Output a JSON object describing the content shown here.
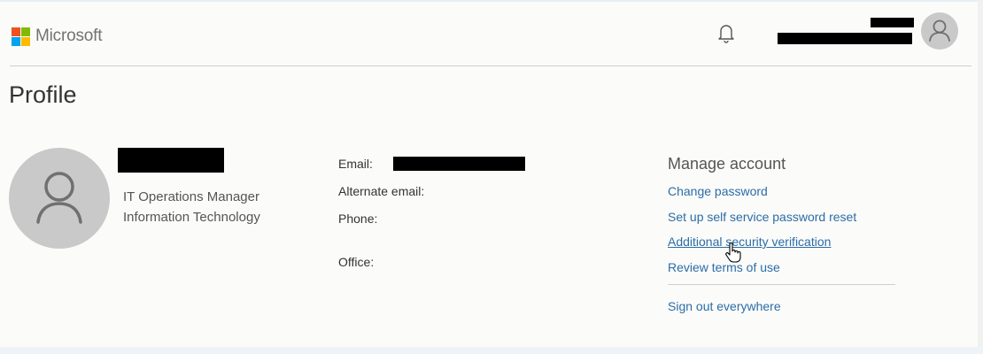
{
  "header": {
    "brand": "Microsoft",
    "logo_colors": [
      "#f25022",
      "#7fba00",
      "#00a4ef",
      "#ffb900"
    ],
    "notifications_icon": "bell-icon",
    "user_avatar_icon": "person-icon"
  },
  "page": {
    "title": "Profile"
  },
  "profile": {
    "avatar_icon": "person-icon",
    "job_title": "IT Operations Manager",
    "department": "Information Technology"
  },
  "contact": {
    "email_label": "Email:",
    "alternate_email_label": "Alternate email:",
    "phone_label": "Phone:",
    "office_label": "Office:"
  },
  "manage_account": {
    "heading": "Manage account",
    "links": [
      "Change password",
      "Set up self service password reset",
      "Additional security verification",
      "Review terms of use"
    ],
    "sign_out": "Sign out everywhere"
  },
  "colors": {
    "link": "#2b6da8",
    "avatar_bg": "#c9c9c9"
  }
}
